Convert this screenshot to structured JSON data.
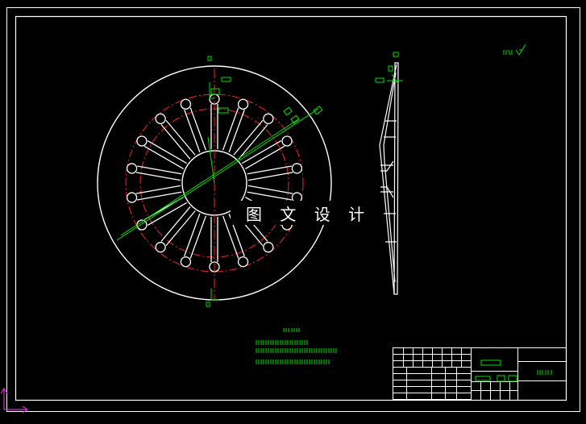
{
  "drawing": {
    "background": "#000000",
    "line_color": "#ffffff",
    "center_line_color": "#ff0000",
    "dimension_color": "#00ff00",
    "ucs_color": "#cc33cc",
    "watermark_text": "图 文 设 计",
    "spoke_count": 18,
    "tech_requirements_lines": 3,
    "icons": [
      "ucs-axis-icon",
      "roughness-symbol-icon"
    ]
  }
}
